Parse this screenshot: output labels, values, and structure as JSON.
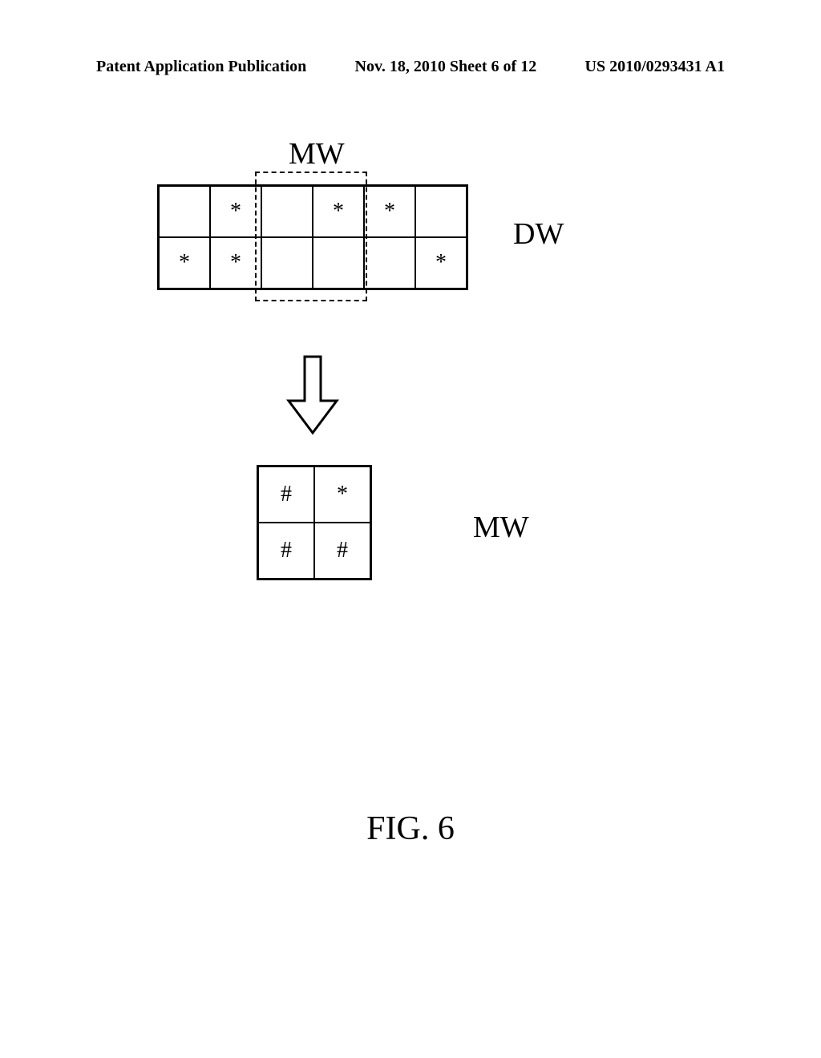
{
  "header": {
    "left": "Patent Application Publication",
    "center": "Nov. 18, 2010  Sheet 6 of 12",
    "right": "US 2010/0293431 A1"
  },
  "labels": {
    "mw_top": "MW",
    "dw_right": "DW",
    "mw_right": "MW"
  },
  "dw_cells": [
    "",
    "*",
    "",
    "*",
    "*",
    "",
    "*",
    "*",
    "",
    "",
    "",
    "*"
  ],
  "mw_cells": [
    "#",
    "*",
    "#",
    "#"
  ],
  "caption": "FIG. 6"
}
